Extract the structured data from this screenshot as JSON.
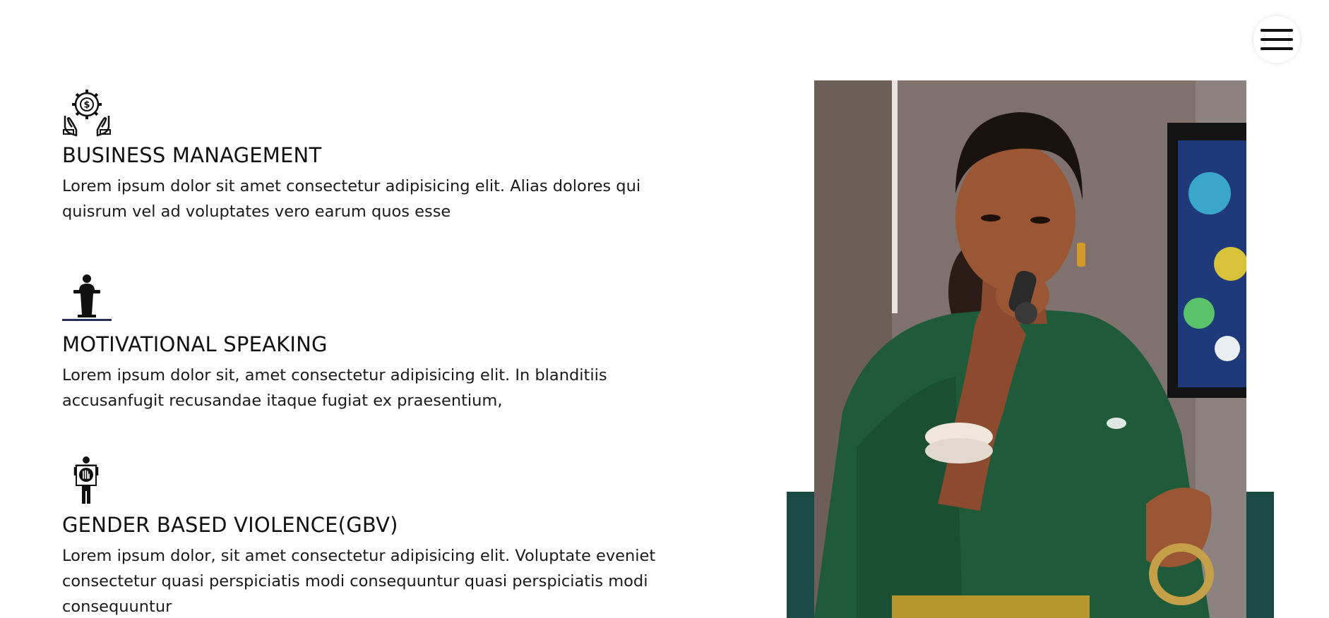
{
  "header": {
    "menu_icon": "hamburger-menu-icon"
  },
  "services": [
    {
      "icon": "hands-gear-dollar-icon",
      "title": "BUSINESS MANAGEMENT",
      "description": "Lorem ipsum dolor sit amet consectetur adipisicing elit. Alias dolores qui quisrum vel ad voluptates vero earum quos esse"
    },
    {
      "icon": "speaker-at-podium-icon",
      "title": "MOTIVATIONAL SPEAKING",
      "description": "Lorem ipsum dolor sit, amet consectetur adipisicing elit. In blanditiis accusanfugit recusandae itaque fugiat ex praesentium,"
    },
    {
      "icon": "person-holding-stop-sign-icon",
      "title": "GENDER BASED VIOLENCE(GBV)",
      "description": "Lorem ipsum dolor, sit amet consectetur adipisicing elit. Voluptate eveniet consectetur quasi perspiciatis modi consequuntur quasi perspiciatis modi consequuntur"
    }
  ],
  "photo": {
    "subject": "woman-speaking-into-microphone-photo"
  },
  "colors": {
    "accent": "#1b4a44",
    "text": "#111111",
    "background": "#ffffff"
  }
}
